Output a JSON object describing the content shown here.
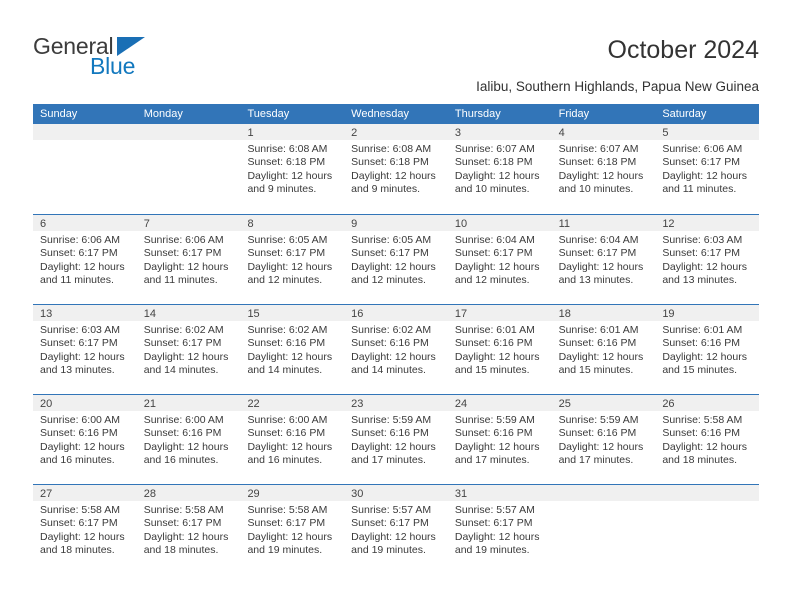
{
  "brand": {
    "name_top": "General",
    "name_bottom": "Blue",
    "flag_color": "#1a6fb5",
    "text_color": "#3c3c3c",
    "blue_color": "#1278be"
  },
  "header": {
    "title": "October 2024",
    "subtitle": "Ialibu, Southern Highlands, Papua New Guinea"
  },
  "theme": {
    "header_blue": "#3275b8",
    "day_band": "#f0f0f0",
    "text": "#333333"
  },
  "weekdays": [
    "Sunday",
    "Monday",
    "Tuesday",
    "Wednesday",
    "Thursday",
    "Friday",
    "Saturday"
  ],
  "weeks": [
    [
      {
        "day": "",
        "sunrise": "",
        "sunset": "",
        "daylight_line1": "",
        "daylight_line2": ""
      },
      {
        "day": "",
        "sunrise": "",
        "sunset": "",
        "daylight_line1": "",
        "daylight_line2": ""
      },
      {
        "day": "1",
        "sunrise": "Sunrise: 6:08 AM",
        "sunset": "Sunset: 6:18 PM",
        "daylight_line1": "Daylight: 12 hours",
        "daylight_line2": "and 9 minutes."
      },
      {
        "day": "2",
        "sunrise": "Sunrise: 6:08 AM",
        "sunset": "Sunset: 6:18 PM",
        "daylight_line1": "Daylight: 12 hours",
        "daylight_line2": "and 9 minutes."
      },
      {
        "day": "3",
        "sunrise": "Sunrise: 6:07 AM",
        "sunset": "Sunset: 6:18 PM",
        "daylight_line1": "Daylight: 12 hours",
        "daylight_line2": "and 10 minutes."
      },
      {
        "day": "4",
        "sunrise": "Sunrise: 6:07 AM",
        "sunset": "Sunset: 6:18 PM",
        "daylight_line1": "Daylight: 12 hours",
        "daylight_line2": "and 10 minutes."
      },
      {
        "day": "5",
        "sunrise": "Sunrise: 6:06 AM",
        "sunset": "Sunset: 6:17 PM",
        "daylight_line1": "Daylight: 12 hours",
        "daylight_line2": "and 11 minutes."
      }
    ],
    [
      {
        "day": "6",
        "sunrise": "Sunrise: 6:06 AM",
        "sunset": "Sunset: 6:17 PM",
        "daylight_line1": "Daylight: 12 hours",
        "daylight_line2": "and 11 minutes."
      },
      {
        "day": "7",
        "sunrise": "Sunrise: 6:06 AM",
        "sunset": "Sunset: 6:17 PM",
        "daylight_line1": "Daylight: 12 hours",
        "daylight_line2": "and 11 minutes."
      },
      {
        "day": "8",
        "sunrise": "Sunrise: 6:05 AM",
        "sunset": "Sunset: 6:17 PM",
        "daylight_line1": "Daylight: 12 hours",
        "daylight_line2": "and 12 minutes."
      },
      {
        "day": "9",
        "sunrise": "Sunrise: 6:05 AM",
        "sunset": "Sunset: 6:17 PM",
        "daylight_line1": "Daylight: 12 hours",
        "daylight_line2": "and 12 minutes."
      },
      {
        "day": "10",
        "sunrise": "Sunrise: 6:04 AM",
        "sunset": "Sunset: 6:17 PM",
        "daylight_line1": "Daylight: 12 hours",
        "daylight_line2": "and 12 minutes."
      },
      {
        "day": "11",
        "sunrise": "Sunrise: 6:04 AM",
        "sunset": "Sunset: 6:17 PM",
        "daylight_line1": "Daylight: 12 hours",
        "daylight_line2": "and 13 minutes."
      },
      {
        "day": "12",
        "sunrise": "Sunrise: 6:03 AM",
        "sunset": "Sunset: 6:17 PM",
        "daylight_line1": "Daylight: 12 hours",
        "daylight_line2": "and 13 minutes."
      }
    ],
    [
      {
        "day": "13",
        "sunrise": "Sunrise: 6:03 AM",
        "sunset": "Sunset: 6:17 PM",
        "daylight_line1": "Daylight: 12 hours",
        "daylight_line2": "and 13 minutes."
      },
      {
        "day": "14",
        "sunrise": "Sunrise: 6:02 AM",
        "sunset": "Sunset: 6:17 PM",
        "daylight_line1": "Daylight: 12 hours",
        "daylight_line2": "and 14 minutes."
      },
      {
        "day": "15",
        "sunrise": "Sunrise: 6:02 AM",
        "sunset": "Sunset: 6:16 PM",
        "daylight_line1": "Daylight: 12 hours",
        "daylight_line2": "and 14 minutes."
      },
      {
        "day": "16",
        "sunrise": "Sunrise: 6:02 AM",
        "sunset": "Sunset: 6:16 PM",
        "daylight_line1": "Daylight: 12 hours",
        "daylight_line2": "and 14 minutes."
      },
      {
        "day": "17",
        "sunrise": "Sunrise: 6:01 AM",
        "sunset": "Sunset: 6:16 PM",
        "daylight_line1": "Daylight: 12 hours",
        "daylight_line2": "and 15 minutes."
      },
      {
        "day": "18",
        "sunrise": "Sunrise: 6:01 AM",
        "sunset": "Sunset: 6:16 PM",
        "daylight_line1": "Daylight: 12 hours",
        "daylight_line2": "and 15 minutes."
      },
      {
        "day": "19",
        "sunrise": "Sunrise: 6:01 AM",
        "sunset": "Sunset: 6:16 PM",
        "daylight_line1": "Daylight: 12 hours",
        "daylight_line2": "and 15 minutes."
      }
    ],
    [
      {
        "day": "20",
        "sunrise": "Sunrise: 6:00 AM",
        "sunset": "Sunset: 6:16 PM",
        "daylight_line1": "Daylight: 12 hours",
        "daylight_line2": "and 16 minutes."
      },
      {
        "day": "21",
        "sunrise": "Sunrise: 6:00 AM",
        "sunset": "Sunset: 6:16 PM",
        "daylight_line1": "Daylight: 12 hours",
        "daylight_line2": "and 16 minutes."
      },
      {
        "day": "22",
        "sunrise": "Sunrise: 6:00 AM",
        "sunset": "Sunset: 6:16 PM",
        "daylight_line1": "Daylight: 12 hours",
        "daylight_line2": "and 16 minutes."
      },
      {
        "day": "23",
        "sunrise": "Sunrise: 5:59 AM",
        "sunset": "Sunset: 6:16 PM",
        "daylight_line1": "Daylight: 12 hours",
        "daylight_line2": "and 17 minutes."
      },
      {
        "day": "24",
        "sunrise": "Sunrise: 5:59 AM",
        "sunset": "Sunset: 6:16 PM",
        "daylight_line1": "Daylight: 12 hours",
        "daylight_line2": "and 17 minutes."
      },
      {
        "day": "25",
        "sunrise": "Sunrise: 5:59 AM",
        "sunset": "Sunset: 6:16 PM",
        "daylight_line1": "Daylight: 12 hours",
        "daylight_line2": "and 17 minutes."
      },
      {
        "day": "26",
        "sunrise": "Sunrise: 5:58 AM",
        "sunset": "Sunset: 6:16 PM",
        "daylight_line1": "Daylight: 12 hours",
        "daylight_line2": "and 18 minutes."
      }
    ],
    [
      {
        "day": "27",
        "sunrise": "Sunrise: 5:58 AM",
        "sunset": "Sunset: 6:17 PM",
        "daylight_line1": "Daylight: 12 hours",
        "daylight_line2": "and 18 minutes."
      },
      {
        "day": "28",
        "sunrise": "Sunrise: 5:58 AM",
        "sunset": "Sunset: 6:17 PM",
        "daylight_line1": "Daylight: 12 hours",
        "daylight_line2": "and 18 minutes."
      },
      {
        "day": "29",
        "sunrise": "Sunrise: 5:58 AM",
        "sunset": "Sunset: 6:17 PM",
        "daylight_line1": "Daylight: 12 hours",
        "daylight_line2": "and 19 minutes."
      },
      {
        "day": "30",
        "sunrise": "Sunrise: 5:57 AM",
        "sunset": "Sunset: 6:17 PM",
        "daylight_line1": "Daylight: 12 hours",
        "daylight_line2": "and 19 minutes."
      },
      {
        "day": "31",
        "sunrise": "Sunrise: 5:57 AM",
        "sunset": "Sunset: 6:17 PM",
        "daylight_line1": "Daylight: 12 hours",
        "daylight_line2": "and 19 minutes."
      },
      {
        "day": "",
        "sunrise": "",
        "sunset": "",
        "daylight_line1": "",
        "daylight_line2": ""
      },
      {
        "day": "",
        "sunrise": "",
        "sunset": "",
        "daylight_line1": "",
        "daylight_line2": ""
      }
    ]
  ]
}
